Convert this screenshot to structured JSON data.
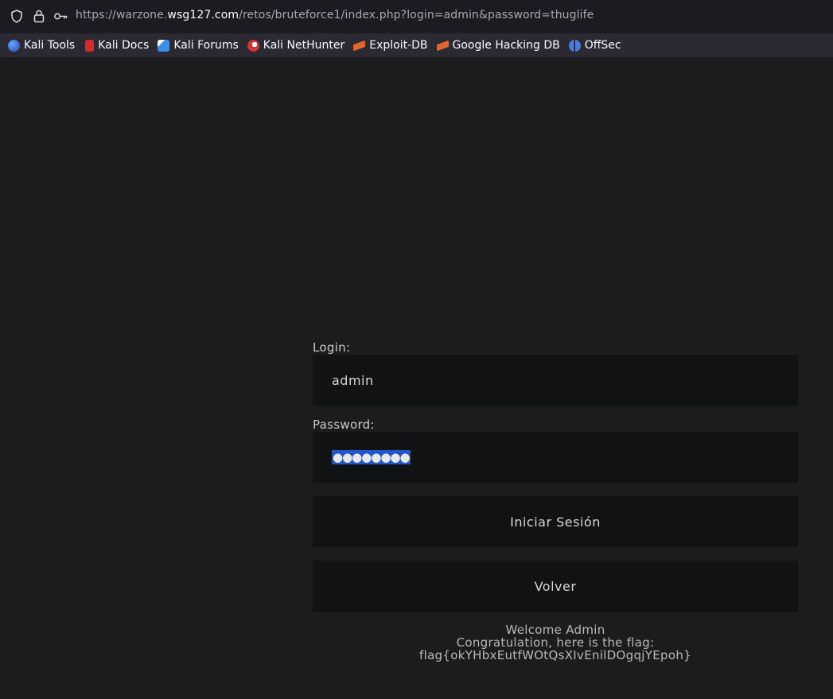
{
  "browser": {
    "url_prefix": "https://warzone.",
    "url_host": "wsg127.com",
    "url_path": "/retos/bruteforce1/index.php?login=admin&password=thuglife"
  },
  "bookmarks": [
    {
      "label": "Kali Tools",
      "color": "#2f6fd6"
    },
    {
      "label": "Kali Docs",
      "color": "#d62b2b"
    },
    {
      "label": "Kali Forums",
      "color": "#3d8ee8"
    },
    {
      "label": "Kali NetHunter",
      "color": "#d63232"
    },
    {
      "label": "Exploit-DB",
      "color": "#e2662a"
    },
    {
      "label": "Google Hacking DB",
      "color": "#e2662a"
    },
    {
      "label": "OffSec",
      "color": "#4a7be0"
    }
  ],
  "form": {
    "login_label": "Login:",
    "login_value": "admin",
    "password_label": "Password:",
    "password_mask": "●●●●●●●●",
    "submit_label": "Iniciar Sesión",
    "back_label": "Volver"
  },
  "message": {
    "welcome": "Welcome Admin",
    "congrats": "Congratulation, here is the flag:",
    "flag": "flag{okYHbxEutfWOtQsXIvEnilDOgqjYEpoh}"
  }
}
